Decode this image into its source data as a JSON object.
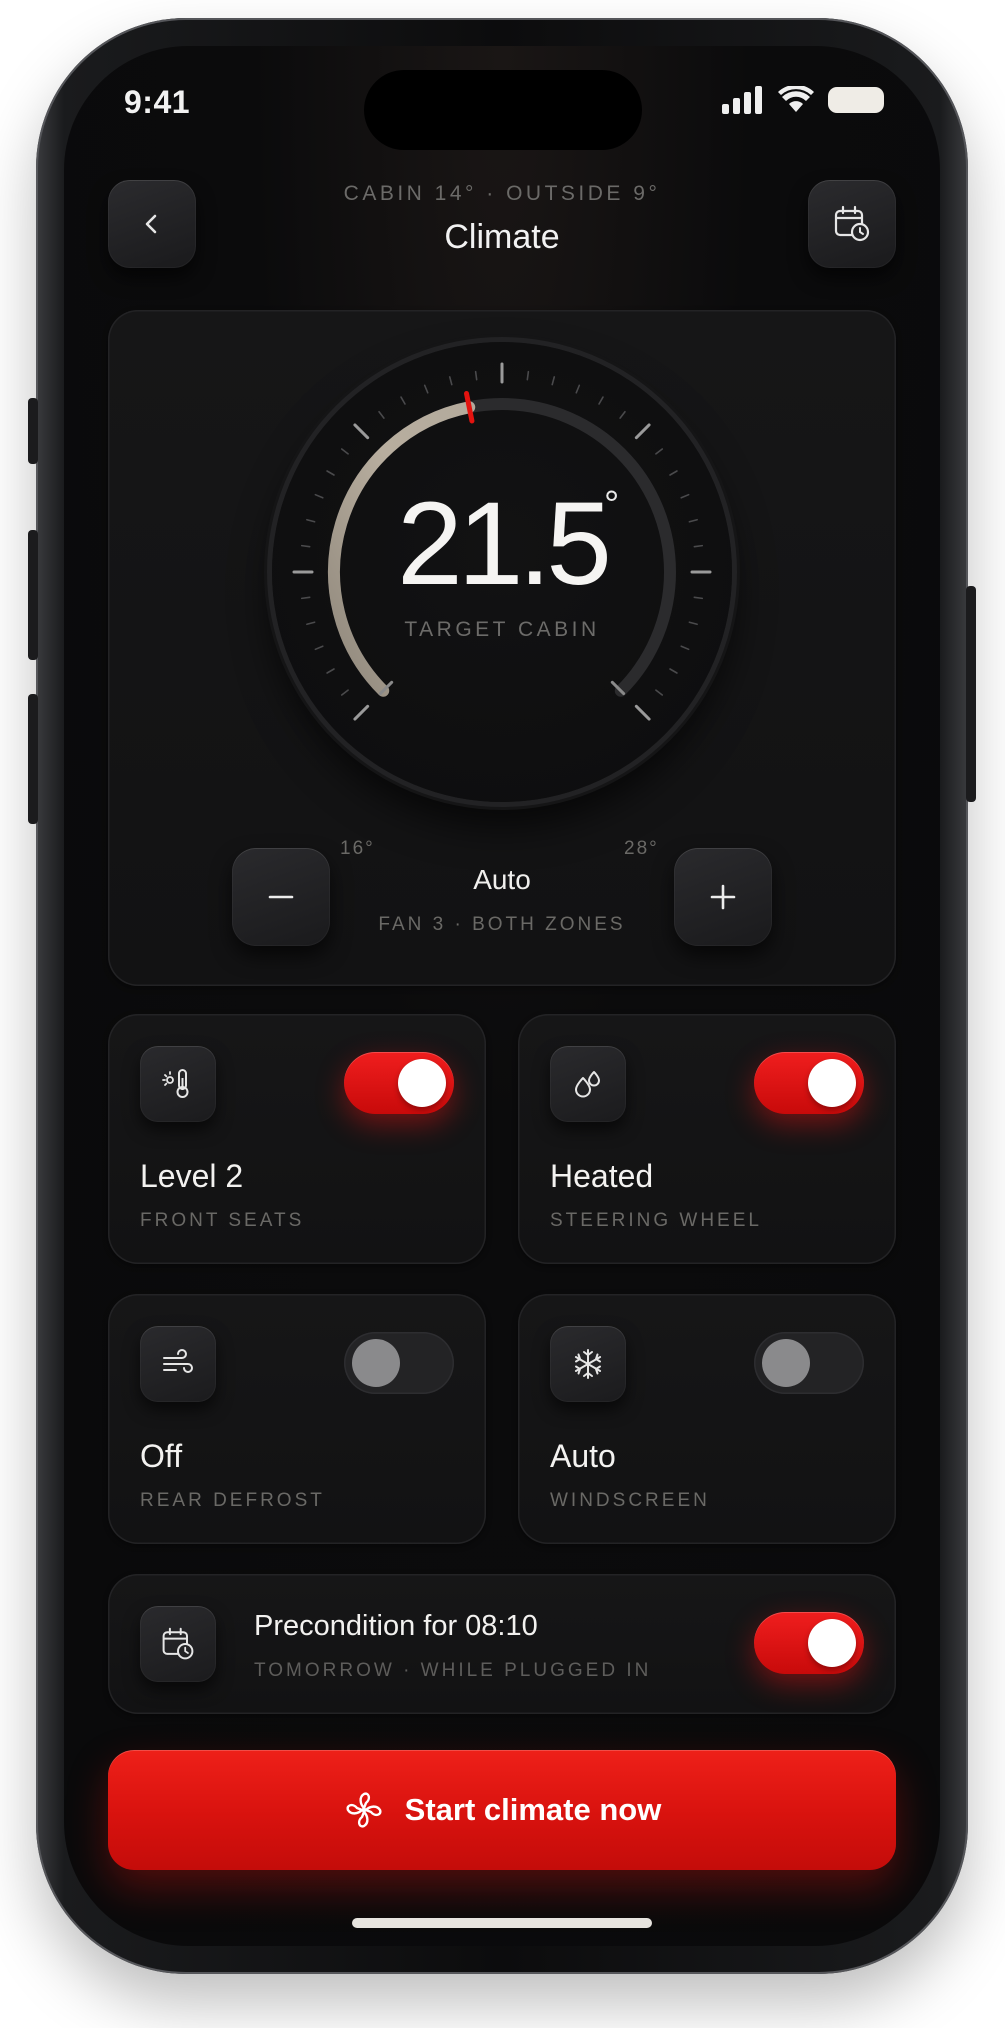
{
  "status_bar": {
    "time": "9:41"
  },
  "header": {
    "subtitle": "CABIN 14° · OUTSIDE 9°",
    "title": "Climate",
    "back_icon": "chevron-left-icon",
    "schedule_icon": "calendar-clock-icon"
  },
  "dial": {
    "value": "21.5",
    "degree": "°",
    "label": "TARGET CABIN",
    "min_label": "16°",
    "max_label": "28°",
    "min": 16,
    "max": 28,
    "target": 21.5
  },
  "fan": {
    "mode": "Auto",
    "detail": "FAN 3 · BOTH ZONES",
    "decrease_icon": "minus-icon",
    "increase_icon": "plus-icon"
  },
  "tiles": [
    {
      "value": "Level 2",
      "label": "FRONT SEATS",
      "icon": "seat-heat-icon",
      "on": true
    },
    {
      "value": "Heated",
      "label": "STEERING WHEEL",
      "icon": "droplets-icon",
      "on": true
    },
    {
      "value": "Off",
      "label": "REAR DEFROST",
      "icon": "wind-icon",
      "on": false
    },
    {
      "value": "Auto",
      "label": "WINDSCREEN",
      "icon": "snowflake-icon",
      "on": false
    }
  ],
  "schedule": {
    "title": "Precondition for 08:10",
    "subtitle": "TOMORROW · WHILE PLUGGED IN",
    "icon": "calendar-clock-icon",
    "on": true
  },
  "cta": {
    "label": "Start climate now",
    "icon": "fan-icon"
  },
  "colors": {
    "accent": "#e3130f",
    "background": "#0b0b0c",
    "card": "#141415",
    "arc": "#b3aa9c"
  }
}
